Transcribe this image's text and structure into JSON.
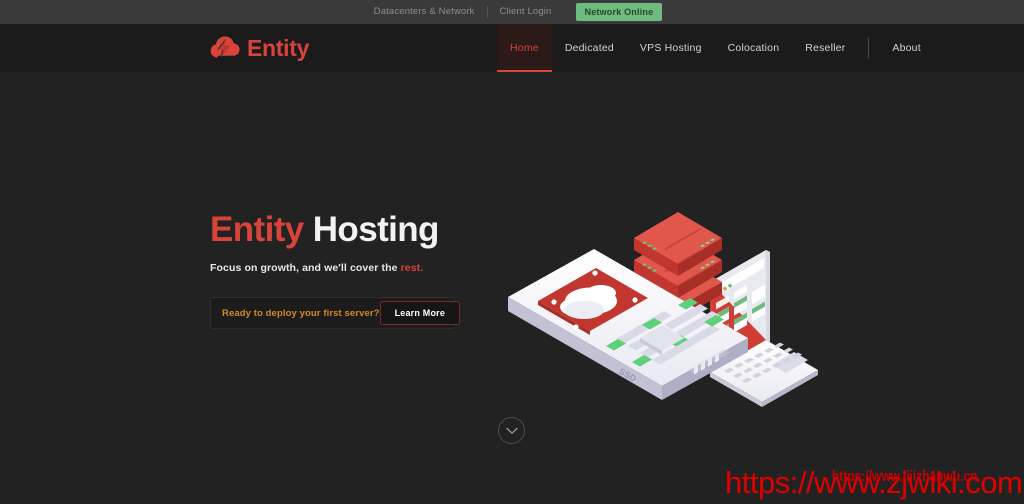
{
  "topbar": {
    "links": [
      {
        "label": "Datacenters & Network"
      },
      {
        "label": "Client Login"
      }
    ],
    "status_badge": "Network Online",
    "badge_color": "#6fbb7d"
  },
  "header": {
    "logo_text": "Entity",
    "logo_icon": "cloud-bolt-icon",
    "logo_color": "#d8433a",
    "nav": [
      {
        "label": "Home",
        "active": true
      },
      {
        "label": "Dedicated",
        "active": false
      },
      {
        "label": "VPS Hosting",
        "active": false
      },
      {
        "label": "Colocation",
        "active": false
      },
      {
        "label": "Reseller",
        "active": false
      },
      {
        "label": "About",
        "active": false
      }
    ]
  },
  "hero": {
    "title_accent": "Entity",
    "title_rest": " Hosting",
    "subtitle_prefix": "Focus on growth, and we'll cover the ",
    "subtitle_accent": "rest.",
    "cta_text": "Ready to deploy your first server?",
    "cta_button": "Learn More",
    "cta_text_color": "#cf8a25",
    "illustration": "isometric-server-ssd-laptop-illustration",
    "scroll_icon": "chevron-down-icon"
  },
  "watermarks": {
    "primary": "https://www.zjwiki.com",
    "secondary": "https://www.lijizhanwu.cn",
    "color": "#e00000"
  }
}
